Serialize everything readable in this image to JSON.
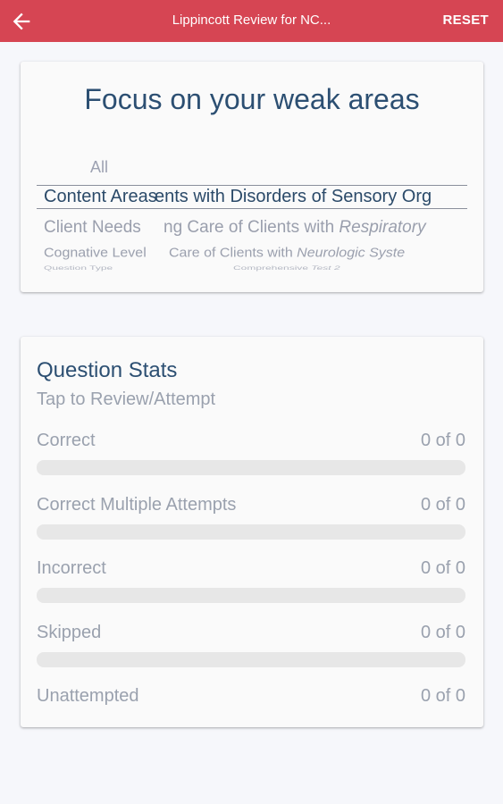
{
  "appbar": {
    "title": "Lippincott Review for NC...",
    "reset_label": "RESET",
    "back_icon": "arrow-left-icon",
    "color": "#d64553"
  },
  "focus": {
    "title": "Focus on your weak areas",
    "filter_types": [
      "All",
      "Content Areas",
      "Client Needs",
      "Cognative Level",
      "Question Type"
    ],
    "selected_filter_type": "Content Areas",
    "filter_values": [
      "",
      "ents with Disorders of Sensory Org",
      "ng Care of Clients with Respiratory",
      "Care of Clients with Neurologic Syste",
      "Comprehensive Test 2"
    ],
    "filter_values_partial": [
      {
        "plain": "",
        "italic": ""
      },
      {
        "plain": "ents with Disorders of Sensory Org",
        "italic": ""
      },
      {
        "plain": "ng Care of Clients with ",
        "italic": "Respiratory"
      },
      {
        "plain": "Care of Clients with ",
        "italic": "Neurologic Syste"
      },
      {
        "plain": "Comprehensive ",
        "italic": "Test 2"
      }
    ]
  },
  "stats": {
    "title": "Question Stats",
    "subtitle": "Tap to Review/Attempt",
    "rows": [
      {
        "label": "Correct",
        "value": "0 of 0",
        "fraction": 0
      },
      {
        "label": "Correct Multiple Attempts",
        "value": "0 of 0",
        "fraction": 0
      },
      {
        "label": "Incorrect",
        "value": "0 of 0",
        "fraction": 0
      },
      {
        "label": "Skipped",
        "value": "0 of 0",
        "fraction": 0
      },
      {
        "label": "Unattempted",
        "value": "0 of 0",
        "fraction": 0
      }
    ]
  }
}
